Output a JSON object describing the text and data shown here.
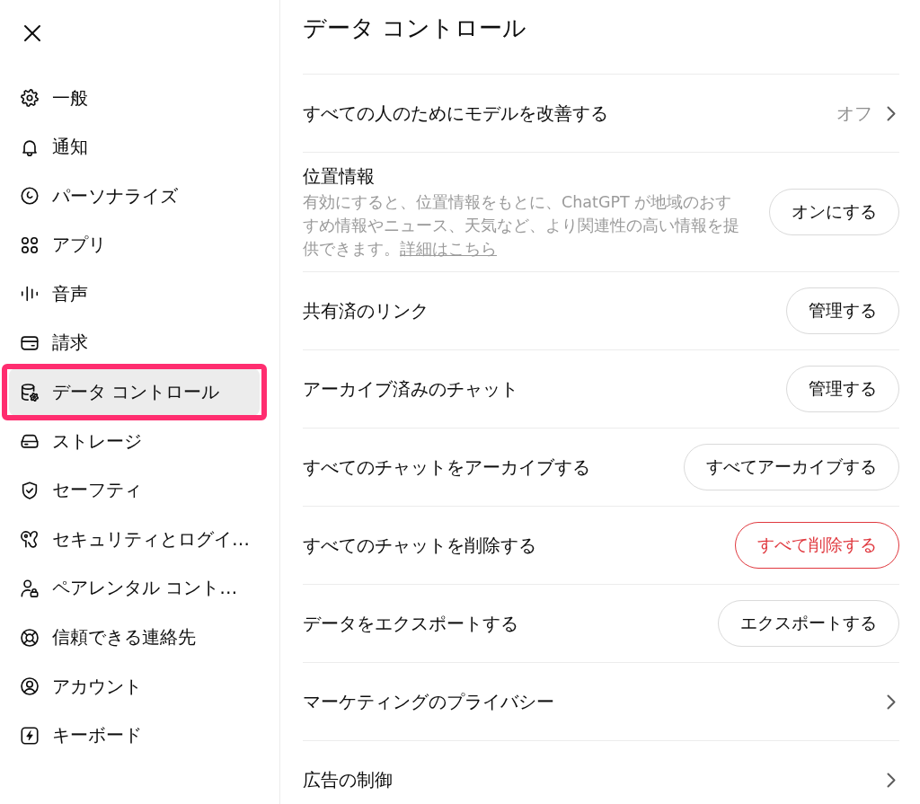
{
  "sidebar": {
    "items": [
      {
        "label": "一般",
        "selected": false,
        "highlighted": false
      },
      {
        "label": "通知",
        "selected": false,
        "highlighted": false
      },
      {
        "label": "パーソナライズ",
        "selected": false,
        "highlighted": false
      },
      {
        "label": "アプリ",
        "selected": false,
        "highlighted": false
      },
      {
        "label": "音声",
        "selected": false,
        "highlighted": false
      },
      {
        "label": "請求",
        "selected": false,
        "highlighted": false
      },
      {
        "label": "データ コントロール",
        "selected": true,
        "highlighted": true
      },
      {
        "label": "ストレージ",
        "selected": false,
        "highlighted": false
      },
      {
        "label": "セーフティ",
        "selected": false,
        "highlighted": false
      },
      {
        "label": "セキュリティとログイ…",
        "selected": false,
        "highlighted": false
      },
      {
        "label": "ペアレンタル コント…",
        "selected": false,
        "highlighted": false
      },
      {
        "label": "信頼できる連絡先",
        "selected": false,
        "highlighted": false
      },
      {
        "label": "アカウント",
        "selected": false,
        "highlighted": false
      },
      {
        "label": "キーボード",
        "selected": false,
        "highlighted": false
      }
    ]
  },
  "main": {
    "title": "データ コントロール",
    "rows": [
      {
        "kind": "chevron",
        "label": "すべての人のためにモデルを改善する",
        "value": "オフ"
      },
      {
        "kind": "button",
        "label": "位置情報",
        "description": "有効にすると、位置情報をもとに、ChatGPT が地域のおすすめ情報やニュース、天気など、より関連性の高い情報を提供できます。",
        "link": "詳細はこちら",
        "button": {
          "label": "オンにする",
          "danger": false
        }
      },
      {
        "kind": "button",
        "label": "共有済のリンク",
        "button": {
          "label": "管理する",
          "danger": false
        }
      },
      {
        "kind": "button",
        "label": "アーカイブ済みのチャット",
        "button": {
          "label": "管理する",
          "danger": false
        }
      },
      {
        "kind": "button",
        "label": "すべてのチャットをアーカイブする",
        "button": {
          "label": "すべてアーカイブする",
          "danger": false
        }
      },
      {
        "kind": "button",
        "label": "すべてのチャットを削除する",
        "button": {
          "label": "すべて削除する",
          "danger": true
        }
      },
      {
        "kind": "button",
        "label": "データをエクスポートする",
        "button": {
          "label": "エクスポートする",
          "danger": false
        }
      },
      {
        "kind": "chevron",
        "label": "マーケティングのプライバシー"
      },
      {
        "kind": "chevron",
        "label": "広告の制御"
      }
    ]
  }
}
